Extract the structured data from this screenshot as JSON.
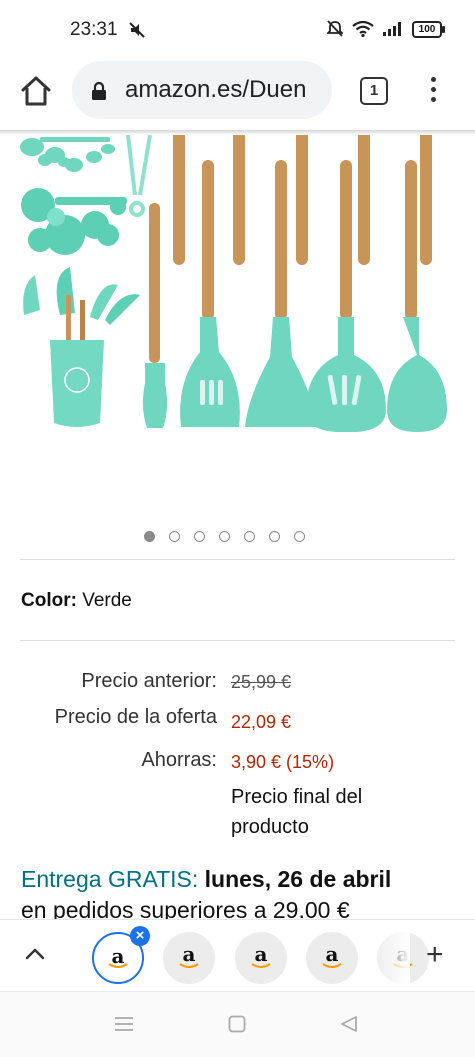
{
  "status_bar": {
    "time": "23:31",
    "battery": "100",
    "icons": [
      "mute-icon",
      "alarm-off-icon",
      "wifi-icon",
      "signal-icon",
      "battery-icon"
    ]
  },
  "browser": {
    "url": "amazon.es/Duen",
    "tab_count": "1"
  },
  "carousel": {
    "total": 7,
    "active_index": 0
  },
  "product": {
    "color_label": "Color:",
    "color_value": "Verde",
    "colors": {
      "silicone": "#6fd6bf",
      "wood": "#c99457"
    }
  },
  "pricing": {
    "previous_label": "Precio anterior:",
    "previous_value": "25,99 €",
    "offer_label": "Precio de la oferta",
    "offer_value": "22,09 €",
    "savings_label": "Ahorras:",
    "savings_value": "3,90 € (15%)",
    "final_note": "Precio final del producto",
    "price_color": "#b12704"
  },
  "delivery": {
    "prefix": "Entrega GRATIS:",
    "date": "lunes, 26 de abril",
    "condition": "en pedidos superiores a 29.00 €",
    "link_color": "#007185"
  },
  "tab_strip": {
    "tabs": [
      {
        "icon": "amazon-icon",
        "letter": "a",
        "selected": true
      },
      {
        "icon": "amazon-icon",
        "letter": "a",
        "selected": false
      },
      {
        "icon": "amazon-icon",
        "letter": "a",
        "selected": false
      },
      {
        "icon": "amazon-icon",
        "letter": "a",
        "selected": false
      },
      {
        "icon": "amazon-icon",
        "letter": "a",
        "selected": false
      }
    ],
    "close_glyph": "×",
    "new_tab_glyph": "+"
  },
  "colors": {
    "accent": "#1a73e8",
    "url_bar_bg": "#f1f3f4"
  }
}
